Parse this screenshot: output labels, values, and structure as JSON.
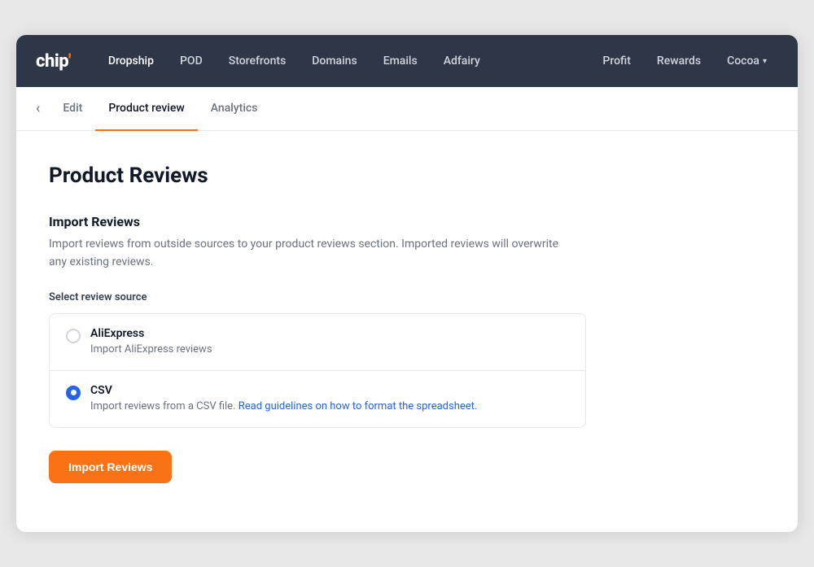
{
  "navbar": {
    "logo_text": "chip'",
    "nav_links": [
      {
        "id": "dropship",
        "label": "Dropship",
        "active": true
      },
      {
        "id": "pod",
        "label": "POD",
        "active": false
      },
      {
        "id": "storefronts",
        "label": "Storefronts",
        "active": false
      },
      {
        "id": "domains",
        "label": "Domains",
        "active": false
      },
      {
        "id": "emails",
        "label": "Emails",
        "active": false
      },
      {
        "id": "adfairy",
        "label": "Adfairy",
        "active": false
      }
    ],
    "nav_right": [
      {
        "id": "profit",
        "label": "Profit"
      },
      {
        "id": "rewards",
        "label": "Rewards"
      }
    ],
    "cocoa_label": "Cocoa"
  },
  "tabs": {
    "back_label": "‹",
    "items": [
      {
        "id": "edit",
        "label": "Edit",
        "active": false
      },
      {
        "id": "product-review",
        "label": "Product review",
        "active": true
      },
      {
        "id": "analytics",
        "label": "Analytics",
        "active": false
      }
    ]
  },
  "page": {
    "title": "Product Reviews",
    "section_title": "Import Reviews",
    "section_desc": "Import reviews from outside sources to your product reviews section. Imported reviews will overwrite any existing reviews.",
    "select_label": "Select review source",
    "options": [
      {
        "id": "aliexpress",
        "label": "AliExpress",
        "desc": "Import AliExpress reviews",
        "desc_link": null,
        "desc_link_text": null,
        "selected": false
      },
      {
        "id": "csv",
        "label": "CSV",
        "desc": "Import reviews from a CSV file. ",
        "desc_link": "Read guidelines on how to format the spreadsheet.",
        "desc_link_url": "#",
        "selected": true
      }
    ],
    "import_button_label": "Import Reviews"
  }
}
